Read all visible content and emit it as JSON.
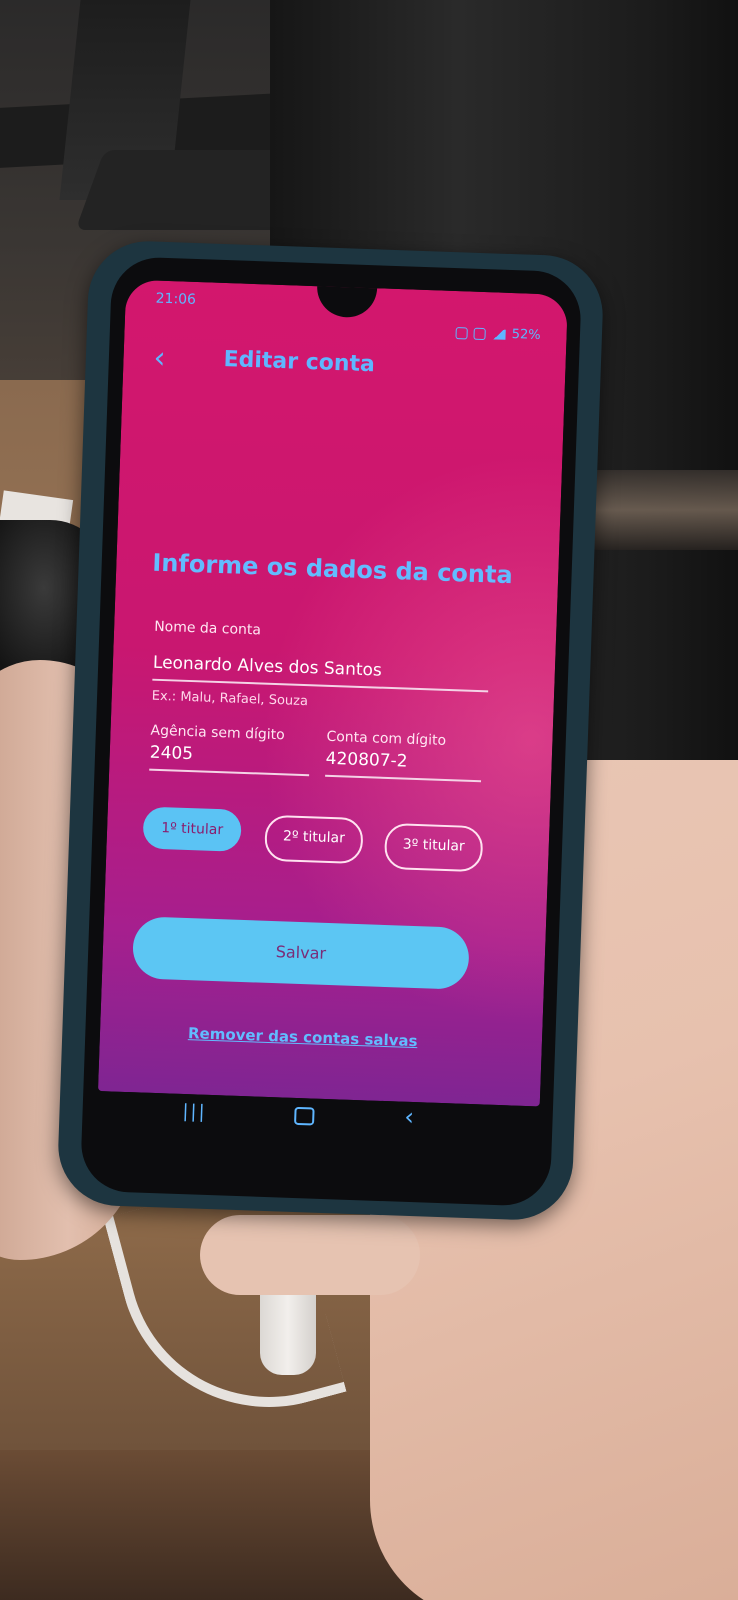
{
  "status": {
    "time": "21:06",
    "battery": "52%"
  },
  "header": {
    "title": "Editar conta",
    "back_icon": "chevron-left-icon"
  },
  "form": {
    "section_title": "Informe os dados da conta",
    "account_name": {
      "label": "Nome da conta",
      "value": "Leonardo Alves dos Santos",
      "hint": "Ex.: Malu, Rafael, Souza"
    },
    "agency": {
      "label": "Agência sem dígito",
      "value": "2405"
    },
    "account_number": {
      "label": "Conta com dígito",
      "value": "420807-2"
    },
    "holders": [
      {
        "label": "1º titular",
        "selected": true
      },
      {
        "label": "2º titular",
        "selected": false
      },
      {
        "label": "3º titular",
        "selected": false
      }
    ],
    "save_label": "Salvar",
    "remove_label": "Remover das contas salvas"
  },
  "colors": {
    "screen_top": "#d3176d",
    "screen_bottom": "#7f2592",
    "accent": "#5cc6f3",
    "text_blue": "#62bcff"
  }
}
